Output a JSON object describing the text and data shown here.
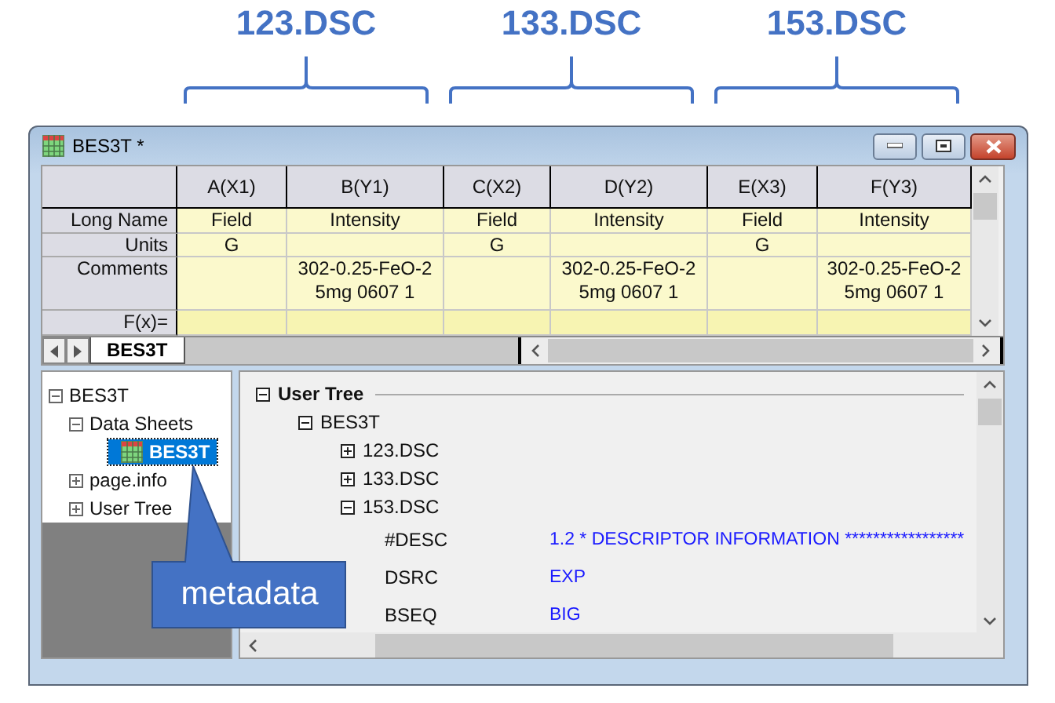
{
  "annotations": [
    {
      "label": "123.DSC"
    },
    {
      "label": "133.DSC"
    },
    {
      "label": "153.DSC"
    }
  ],
  "window": {
    "title": "BES3T *"
  },
  "worksheet": {
    "row_labels": [
      "Long Name",
      "Units",
      "Comments",
      "F(x)="
    ],
    "columns": [
      {
        "name": "A(X1)",
        "long_name": "Field",
        "units": "G"
      },
      {
        "name": "B(Y1)",
        "long_name": "Intensity",
        "comments": "302-0.25-FeO-2\n5mg 0607 1"
      },
      {
        "name": "C(X2)",
        "long_name": "Field",
        "units": "G"
      },
      {
        "name": "D(Y2)",
        "long_name": "Intensity",
        "comments": "302-0.25-FeO-2\n5mg 0607 1"
      },
      {
        "name": "E(X3)",
        "long_name": "Field",
        "units": "G"
      },
      {
        "name": "F(Y3)",
        "long_name": "Intensity",
        "comments": "302-0.25-FeO-2\n5mg 0607 1"
      }
    ]
  },
  "sheet_tabs": [
    {
      "label": "BES3T",
      "selected": true
    }
  ],
  "sidebar": {
    "items": [
      {
        "label": "BES3T",
        "expanded": true,
        "selected": false,
        "children": [
          {
            "label": "Data Sheets",
            "expanded": true,
            "selected": false,
            "children": [
              {
                "label": "BES3T",
                "kind": "sheet",
                "selected": true
              }
            ]
          },
          {
            "label": "page.info",
            "expanded": false,
            "selected": false
          },
          {
            "label": "User Tree",
            "expanded": false,
            "selected": false
          }
        ]
      }
    ]
  },
  "user_tree": {
    "title": "User Tree",
    "expanded": true,
    "children": [
      {
        "label": "BES3T",
        "expanded": true,
        "children": [
          {
            "label": "123.DSC",
            "expanded": false
          },
          {
            "label": "133.DSC",
            "expanded": false
          },
          {
            "label": "153.DSC",
            "expanded": true,
            "entries": [
              {
                "key": "#DESC",
                "value": "1.2 * DESCRIPTOR INFORMATION *****************"
              },
              {
                "key": "DSRC",
                "value": "EXP"
              },
              {
                "key": "BSEQ",
                "value": "BIG"
              }
            ]
          }
        ]
      }
    ]
  },
  "callout": {
    "text": "metadata"
  }
}
